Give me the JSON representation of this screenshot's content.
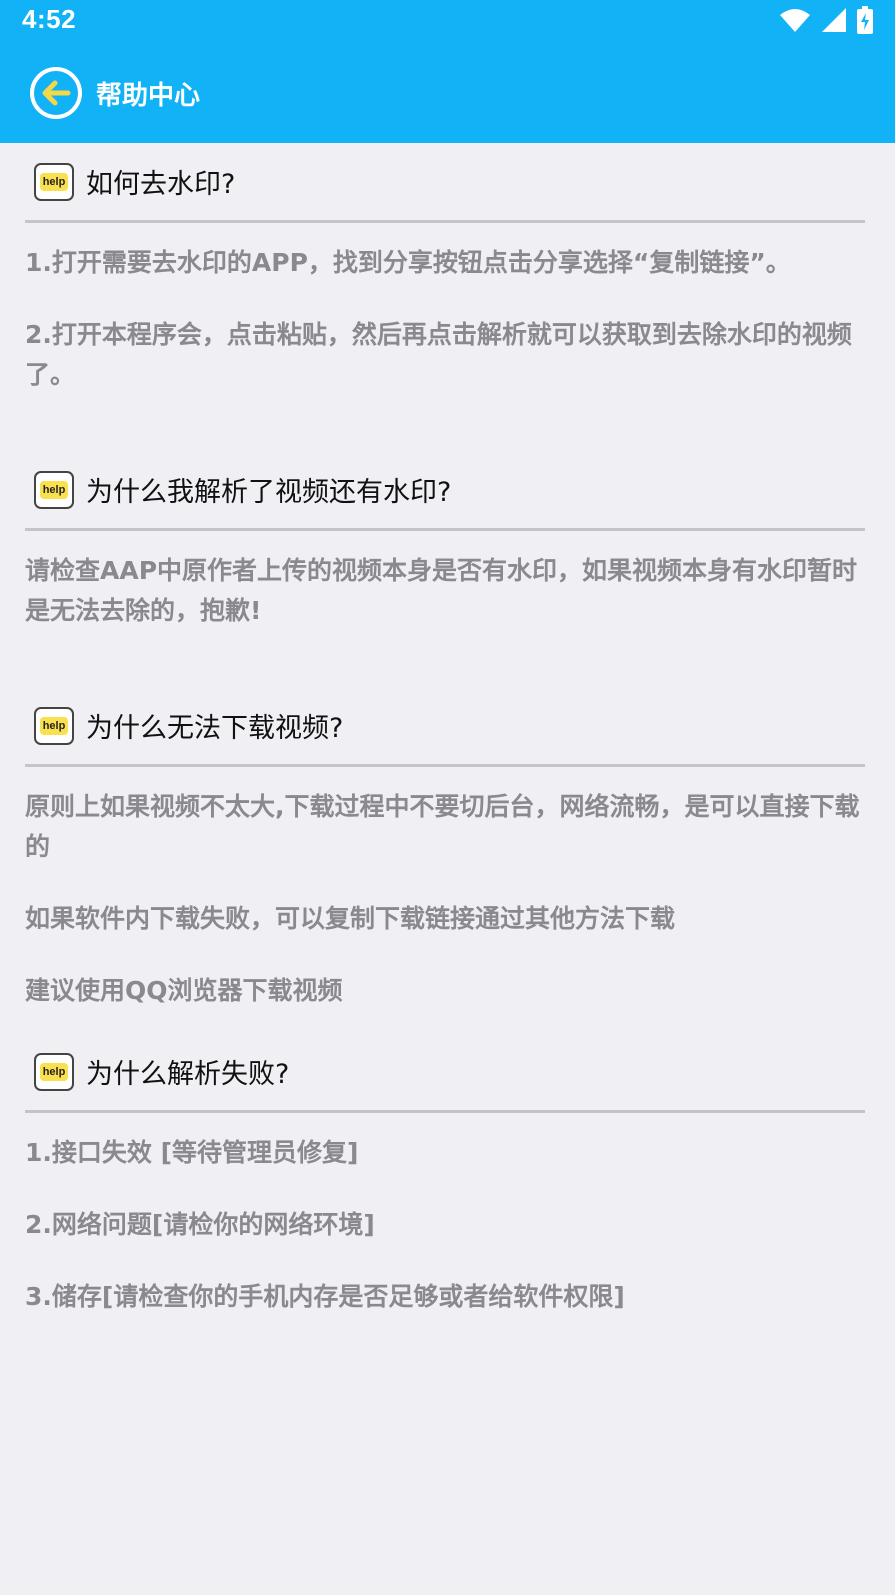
{
  "status_bar": {
    "time": "4:52",
    "icons": [
      "wifi-icon",
      "signal-icon",
      "battery-icon"
    ]
  },
  "app_bar": {
    "title": "帮助中心",
    "back_icon": "back-arrow-icon"
  },
  "colors": {
    "primary": "#11b2f6",
    "background": "#efeff4",
    "badge_yellow": "#fadf4f",
    "text_gray": "#8a8a8e",
    "divider": "#c4c4c8"
  },
  "sections": [
    {
      "badge": "help",
      "title": "如何去水印?",
      "paragraphs": [
        "1.打开需要去水印的APP，找到分享按钮点击分享选择“复制链接”。",
        "2.打开本程序会，点击粘贴，然后再点击解析就可以获取到去除水印的视频了。"
      ]
    },
    {
      "badge": "help",
      "title": "为什么我解析了视频还有水印?",
      "paragraphs": [
        "请检查AAP中原作者上传的视频本身是否有水印，如果视频本身有水印暂时是无法去除的，抱歉!"
      ]
    },
    {
      "badge": "help",
      "title": "为什么无法下载视频?",
      "paragraphs": [
        "原则上如果视频不太大,下载过程中不要切后台，网络流畅，是可以直接下载的",
        "如果软件内下载失败，可以复制下载链接通过其他方法下载",
        "建议使用QQ浏览器下载视频"
      ]
    },
    {
      "badge": "help",
      "title": "为什么解析失败?",
      "paragraphs": [
        "1.接口失效 [等待管理员修复]",
        "2.网络问题[请检你的网络环境]",
        "3.储存[请检查你的手机内存是否足够或者给软件权限]"
      ]
    }
  ]
}
